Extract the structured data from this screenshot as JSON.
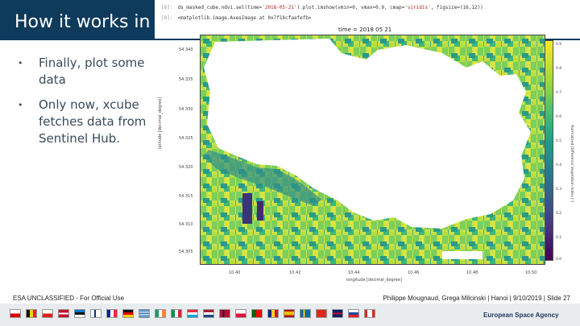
{
  "slide": {
    "title": "How it works in",
    "bullets": [
      "Finally, plot some data",
      "Only now, xcube fetches data from Sentinel Hub."
    ],
    "bullet_glyph": "•"
  },
  "notebook": {
    "line1_prompt": "[8]:",
    "line1_code_a": "ds_masked_cube.ndvi.sel(time=",
    "line1_string": "'2018-05-21'",
    "line1_code_b": ").plot.imshow(vmin=0, vmax=0.9, cmap=",
    "line1_cmap": "'viridis'",
    "line1_code_c": ", figsize=(16,12))",
    "line2_prompt": "[8]:",
    "line2_output": "<matplotlib.image.AxesImage at 0x7f1bcfaafefb>"
  },
  "chart_data": {
    "type": "heatmap",
    "title": "time = 2018 05 21",
    "xlabel": "longitude [decimal_degree]",
    "ylabel": "latitude [decimal_degree]",
    "colorbar_label": "Normalized Difference Vegetation Index [-]",
    "yticks": [
      "54.340",
      "54.335",
      "54.330",
      "54.325",
      "54.320",
      "54.315",
      "54.310",
      "54.305"
    ],
    "xticks": [
      "10.40",
      "10.42",
      "10.44",
      "10.46",
      "10.48",
      "10.50"
    ],
    "colorbar_ticks": [
      "0.9",
      "0.8",
      "0.7",
      "0.6",
      "0.5",
      "0.4",
      "0.3",
      "0.2",
      "0.1",
      "0.0"
    ],
    "vmin": 0.0,
    "vmax": 0.9,
    "colormap": "viridis"
  },
  "footer": {
    "classification": "ESA UNCLASSIFIED - For Official Use",
    "credit": "Philippe Mougnaud, Grega Milcinski | Hanoi | 9/10/2019 | Slide  27",
    "organization": "European Space Agency"
  },
  "colors": {
    "header": "#0e3a5c",
    "text": "#3a4a5a",
    "water": "#ffffff"
  }
}
